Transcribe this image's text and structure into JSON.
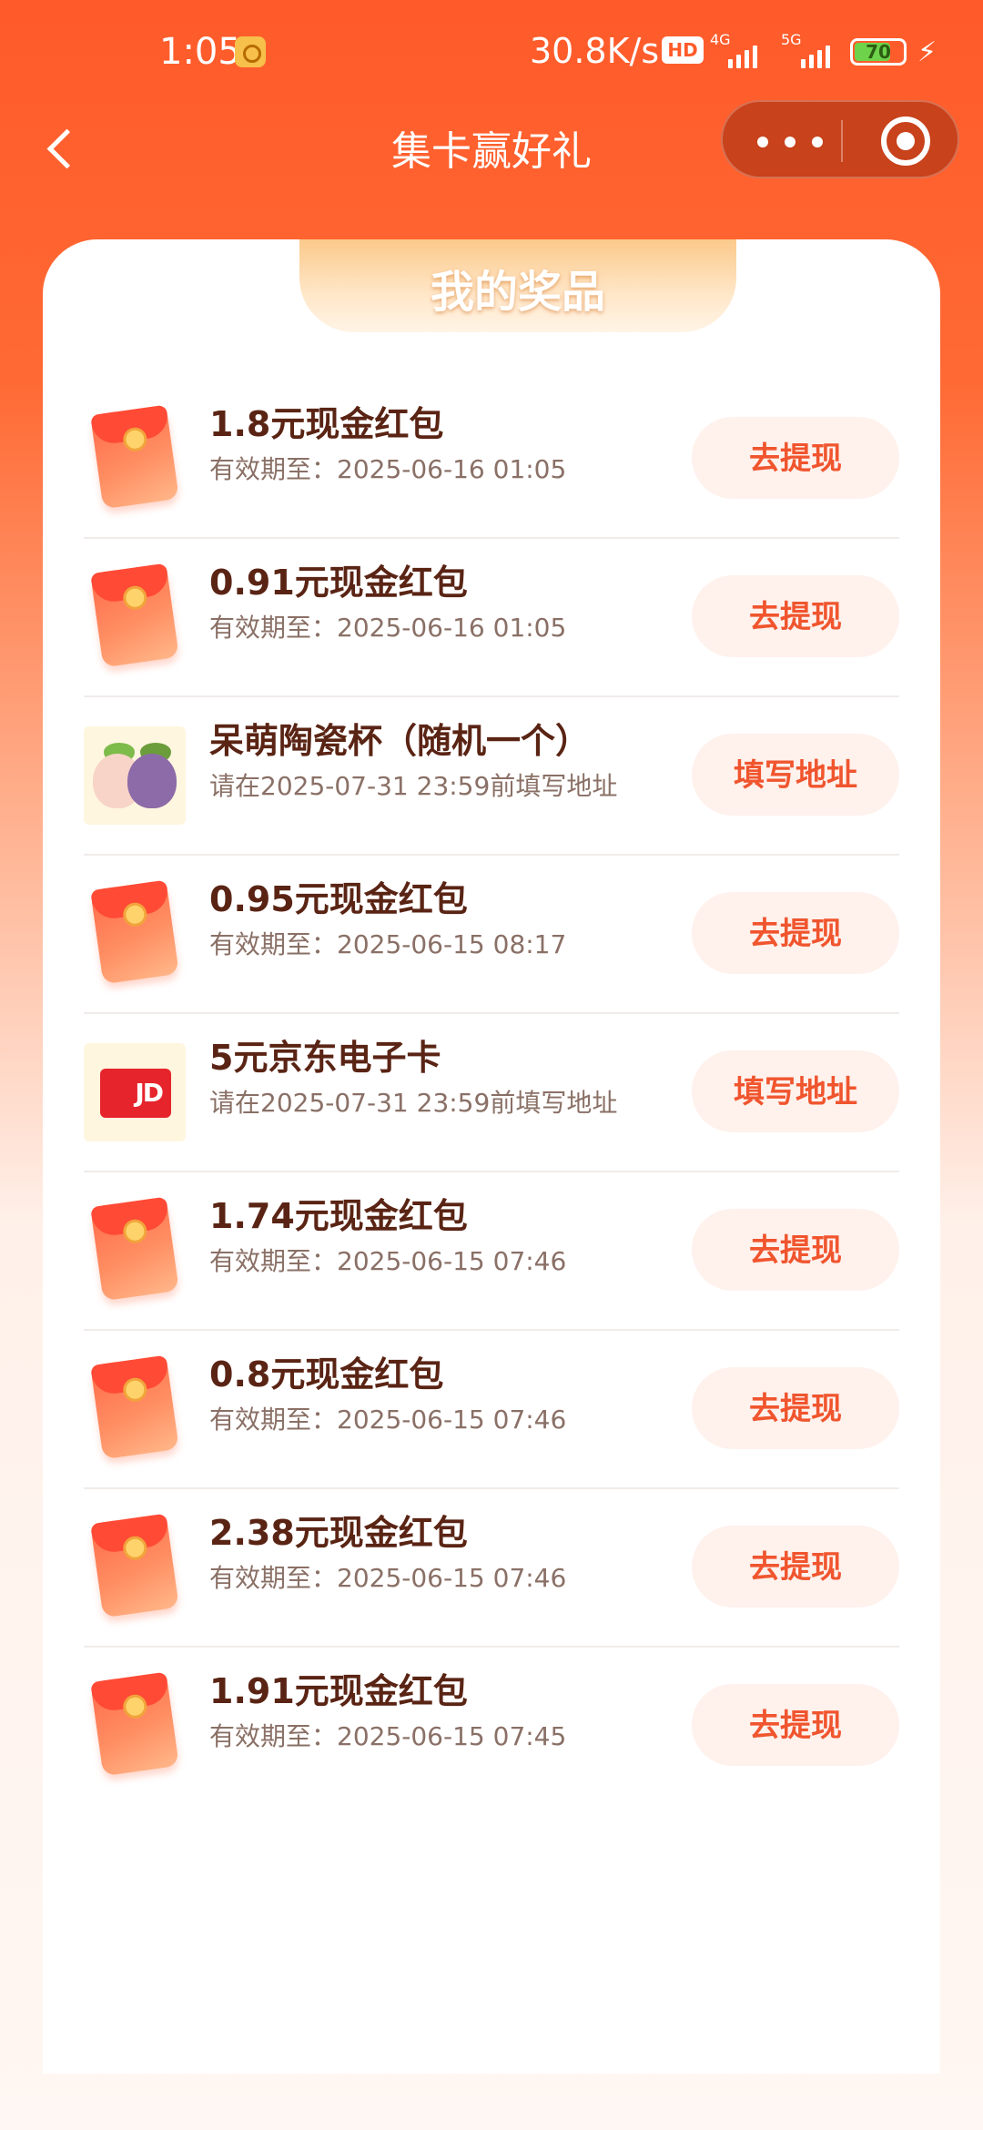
{
  "status_bar": {
    "time": "1:05",
    "net_speed": "30.8K/s",
    "hd_label": "HD",
    "sig1_label": "4G",
    "sig2_label": "5G",
    "battery": "70"
  },
  "nav": {
    "title": "集卡赢好礼"
  },
  "card": {
    "banner_title": "我的奖品"
  },
  "prizes": [
    {
      "title": "1.8元现金红包",
      "sub": "有效期至：2025-06-16 01:05",
      "button": "去提现",
      "icon": "red-packet"
    },
    {
      "title": "0.91元现金红包",
      "sub": "有效期至：2025-06-16 01:05",
      "button": "去提现",
      "icon": "red-packet"
    },
    {
      "title": "呆萌陶瓷杯（随机一个）",
      "sub": "请在2025-07-31 23:59前填写地址",
      "button": "填写地址",
      "icon": "ceramic-cups"
    },
    {
      "title": "0.95元现金红包",
      "sub": "有效期至：2025-06-15 08:17",
      "button": "去提现",
      "icon": "red-packet"
    },
    {
      "title": "5元京东电子卡",
      "sub": "请在2025-07-31 23:59前填写地址",
      "button": "填写地址",
      "icon": "jd-card",
      "card_text": "JD"
    },
    {
      "title": "1.74元现金红包",
      "sub": "有效期至：2025-06-15 07:46",
      "button": "去提现",
      "icon": "red-packet"
    },
    {
      "title": "0.8元现金红包",
      "sub": "有效期至：2025-06-15 07:46",
      "button": "去提现",
      "icon": "red-packet"
    },
    {
      "title": "2.38元现金红包",
      "sub": "有效期至：2025-06-15 07:46",
      "button": "去提现",
      "icon": "red-packet"
    },
    {
      "title": "1.91元现金红包",
      "sub": "有效期至：2025-06-15 07:45",
      "button": "去提现",
      "icon": "red-packet"
    }
  ]
}
